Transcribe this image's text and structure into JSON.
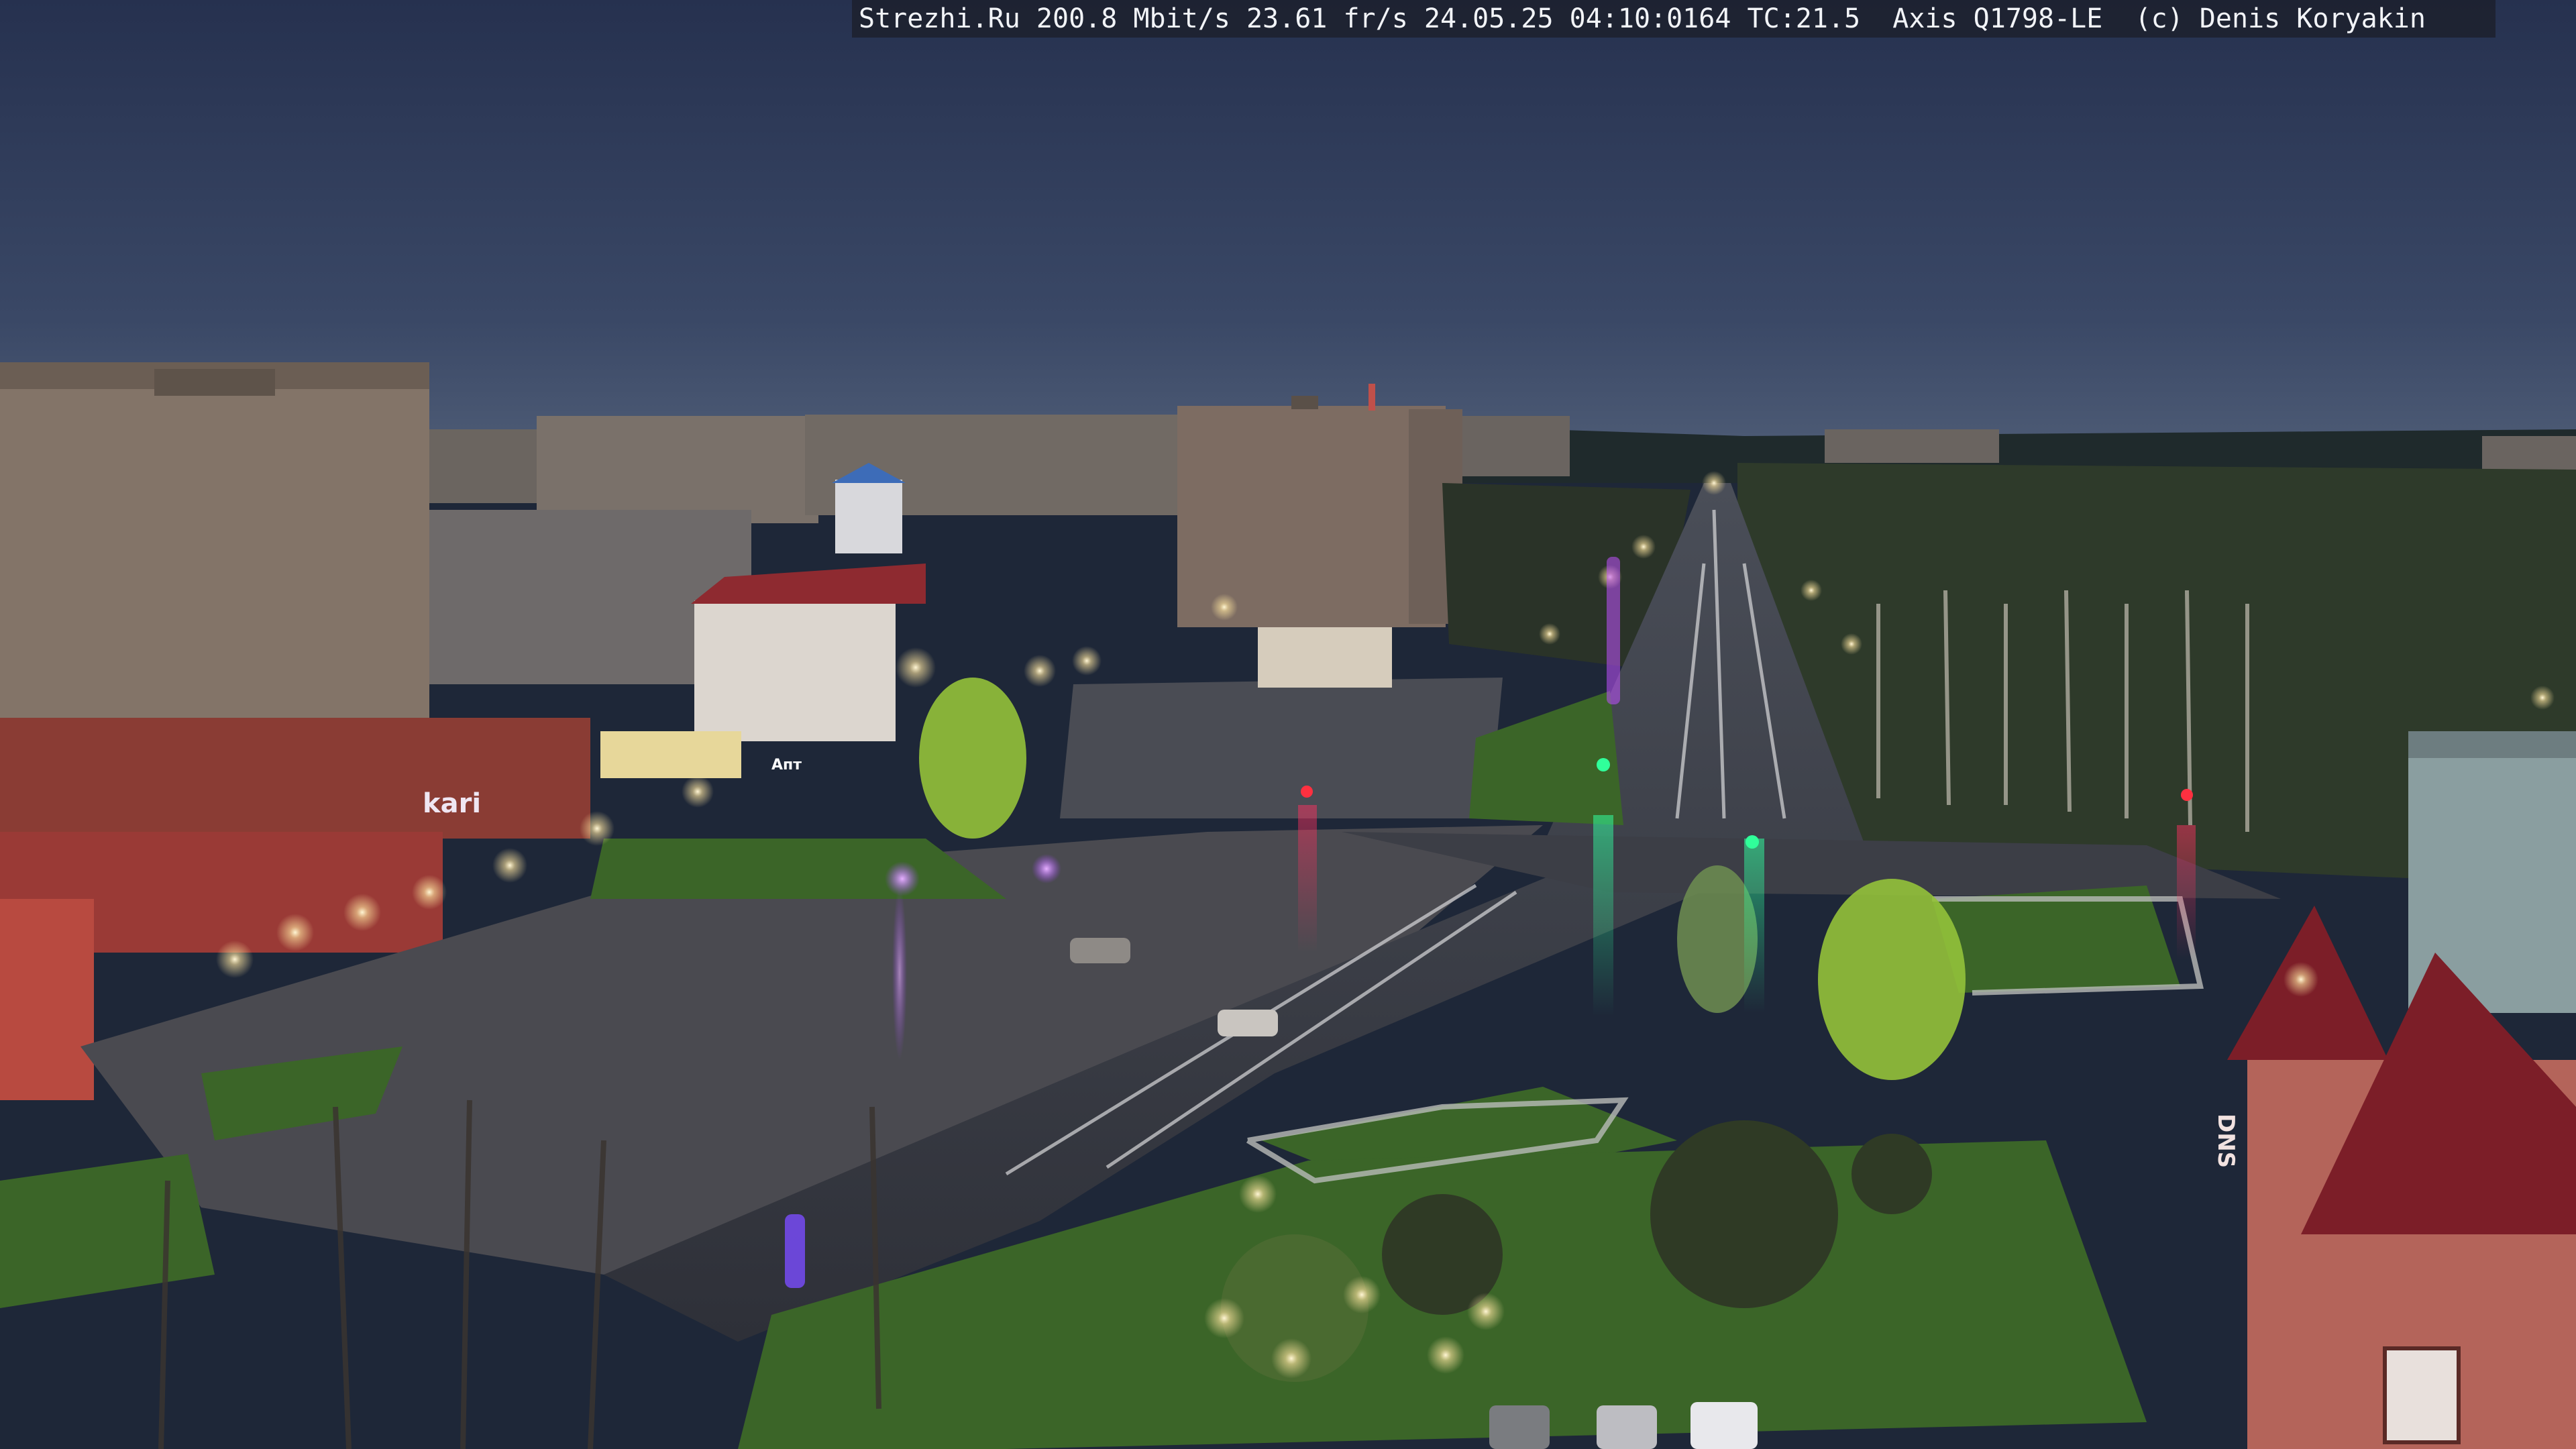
{
  "osd": {
    "text": "Strezhi.Ru 200.8 Mbit/s 23.61 fr/s 24.05.25 04:10:0164 TC:21.5  Axis Q1798-LE  (c) Denis Koryakin"
  },
  "signs": {
    "store_sign": "kari",
    "pharmacy_sign": "Апт",
    "dns_sign": "DNS"
  },
  "colors": {
    "sky_top": "#2c3a5c",
    "sky_horizon": "#4a5a78",
    "wet_asphalt": "#3a3e48",
    "grass": "#3e6a2a",
    "building_brick": "#7e6e64",
    "shop_red": "#8c2a2a",
    "roof_red": "#8a1e28",
    "street_light": "#ffe9b0",
    "neon_purple": "#b14cff",
    "traffic_green": "#2cff9a",
    "traffic_red": "#ff3040"
  }
}
